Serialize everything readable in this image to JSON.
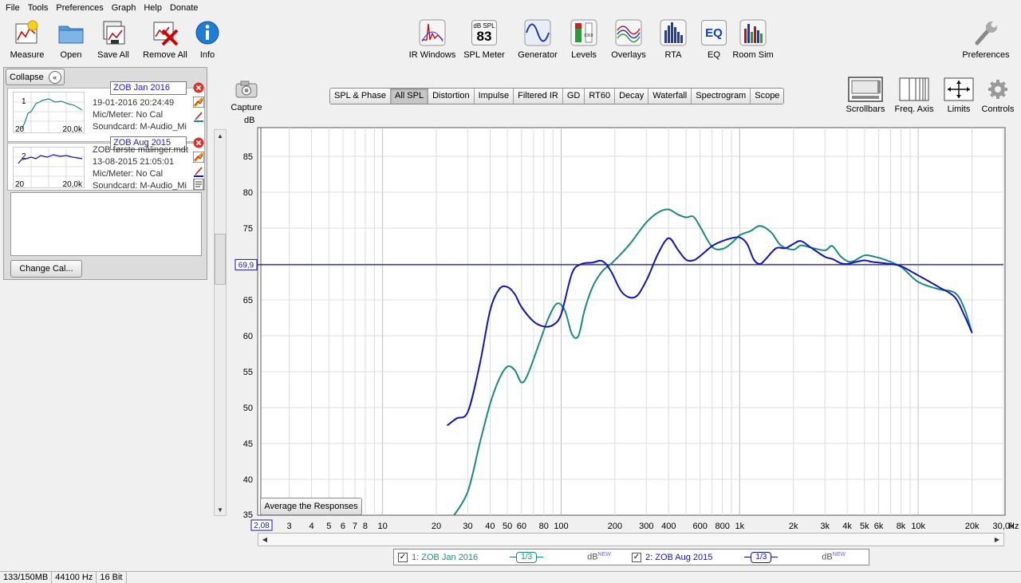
{
  "menu": [
    "File",
    "Tools",
    "Preferences",
    "Graph",
    "Help",
    "Donate"
  ],
  "toolbar_left": [
    {
      "label": "Measure",
      "icon": "measure-icon"
    },
    {
      "label": "Open",
      "icon": "folder-icon"
    },
    {
      "label": "Save All",
      "icon": "save-all-icon"
    },
    {
      "label": "Remove All",
      "icon": "remove-all-icon"
    },
    {
      "label": "Info",
      "icon": "info-icon"
    }
  ],
  "toolbar_center": [
    {
      "label": "IR Windows",
      "icon": "ir-windows-icon"
    },
    {
      "label": "SPL Meter",
      "icon": "spl-meter-icon",
      "top": "dB SPL",
      "value": "83"
    },
    {
      "label": "Generator",
      "icon": "generator-icon"
    },
    {
      "label": "Levels",
      "icon": "levels-icon"
    },
    {
      "label": "Overlays",
      "icon": "overlays-icon"
    },
    {
      "label": "RTA",
      "icon": "rta-icon"
    },
    {
      "label": "EQ",
      "icon": "eq-icon",
      "text": "EQ"
    },
    {
      "label": "Room Sim",
      "icon": "room-sim-icon"
    }
  ],
  "preferences": {
    "label": "Preferences"
  },
  "panel": {
    "collapse": "Collapse",
    "measurements": [
      {
        "num": "1",
        "name": "ZOB Jan 2016",
        "lines": [
          "19-01-2016 20:24:49",
          "Mic/Meter: No Cal",
          "Soundcard: M-Audio_Mi"
        ],
        "x0": "20",
        "x1": "20,0k",
        "color": "#1a8a80"
      },
      {
        "num": "2",
        "name": "ZOB Aug 2015",
        "lines": [
          "ZOB første målinger.mdat",
          "13-08-2015 21:05:01",
          "Mic/Meter: No Cal",
          "Soundcard: M-Audio_Mi"
        ],
        "x0": "20",
        "x1": "20,0k",
        "color": "#1414b4"
      }
    ],
    "change_cal": "Change Cal..."
  },
  "capture": {
    "label": "Capture"
  },
  "tabs": [
    "SPL & Phase",
    "All SPL",
    "Distortion",
    "Impulse",
    "Filtered IR",
    "GD",
    "RT60",
    "Decay",
    "Waterfall",
    "Spectrogram",
    "Scope"
  ],
  "active_tab": "All SPL",
  "right_tools": [
    {
      "label": "Scrollbars",
      "icon": "scrollbars-icon"
    },
    {
      "label": "Freq. Axis",
      "icon": "freq-axis-icon"
    },
    {
      "label": "Limits",
      "icon": "limits-icon"
    },
    {
      "label": "Controls",
      "icon": "controls-icon"
    }
  ],
  "avg_button": "Average the Responses",
  "chart_data": {
    "type": "line",
    "ylabel": "dB",
    "xunit": "Hz",
    "xscale": "log",
    "xlim": [
      2.08,
      30000
    ],
    "ylim": [
      35,
      89
    ],
    "x_ticks": [
      {
        "v": 3,
        "t": "3"
      },
      {
        "v": 4,
        "t": "4"
      },
      {
        "v": 5,
        "t": "5"
      },
      {
        "v": 6,
        "t": "6"
      },
      {
        "v": 7,
        "t": "7"
      },
      {
        "v": 8,
        "t": "8"
      },
      {
        "v": 10,
        "t": "10"
      },
      {
        "v": 20,
        "t": "20"
      },
      {
        "v": 30,
        "t": "30"
      },
      {
        "v": 40,
        "t": "40"
      },
      {
        "v": 50,
        "t": "50"
      },
      {
        "v": 60,
        "t": "60"
      },
      {
        "v": 80,
        "t": "80"
      },
      {
        "v": 100,
        "t": "100"
      },
      {
        "v": 200,
        "t": "200"
      },
      {
        "v": 300,
        "t": "300"
      },
      {
        "v": 400,
        "t": "400"
      },
      {
        "v": 600,
        "t": "600"
      },
      {
        "v": 800,
        "t": "800"
      },
      {
        "v": 1000,
        "t": "1k"
      },
      {
        "v": 2000,
        "t": "2k"
      },
      {
        "v": 3000,
        "t": "3k"
      },
      {
        "v": 4000,
        "t": "4k"
      },
      {
        "v": 5000,
        "t": "5k"
      },
      {
        "v": 6000,
        "t": "6k"
      },
      {
        "v": 8000,
        "t": "8k"
      },
      {
        "v": 10000,
        "t": "10k"
      },
      {
        "v": 20000,
        "t": "20k"
      },
      {
        "v": 30000,
        "t": "30,0k"
      }
    ],
    "x_start_label": "2,08",
    "y_ticks": [
      40,
      45,
      50,
      55,
      60,
      65,
      70,
      75,
      80,
      85
    ],
    "y_tick_labels": [
      "40",
      "45",
      "50",
      "55",
      "60",
      "65",
      "70",
      "75",
      "80",
      "85"
    ],
    "y_bottom_label": "35",
    "cursor_y": 69.9,
    "cursor_label": "69,9",
    "series": [
      {
        "name": "1: ZOB Jan 2016",
        "color": "#1a8a80",
        "points": [
          [
            25,
            34.9
          ],
          [
            30,
            38.3
          ],
          [
            35,
            45
          ],
          [
            40,
            50.5
          ],
          [
            45,
            54
          ],
          [
            50,
            55.7
          ],
          [
            55,
            55.2
          ],
          [
            60,
            53.5
          ],
          [
            65,
            54.6
          ],
          [
            75,
            58.8
          ],
          [
            85,
            62.5
          ],
          [
            95,
            64.5
          ],
          [
            105,
            63.5
          ],
          [
            115,
            60.2
          ],
          [
            125,
            60
          ],
          [
            135,
            63.5
          ],
          [
            150,
            66.8
          ],
          [
            170,
            69
          ],
          [
            190,
            70
          ],
          [
            220,
            71.6
          ],
          [
            250,
            73.2
          ],
          [
            300,
            75.8
          ],
          [
            350,
            77.2
          ],
          [
            400,
            77.6
          ],
          [
            450,
            76.9
          ],
          [
            500,
            76.5
          ],
          [
            550,
            76.6
          ],
          [
            600,
            75.2
          ],
          [
            700,
            72.4
          ],
          [
            800,
            72.1
          ],
          [
            900,
            72.9
          ],
          [
            1000,
            74
          ],
          [
            1150,
            74.6
          ],
          [
            1300,
            75.3
          ],
          [
            1500,
            74.4
          ],
          [
            1700,
            72.6
          ],
          [
            2000,
            72
          ],
          [
            2200,
            72.6
          ],
          [
            2500,
            72.3
          ],
          [
            3000,
            71.9
          ],
          [
            3300,
            72.5
          ],
          [
            3700,
            71
          ],
          [
            4200,
            70.3
          ],
          [
            5000,
            71.2
          ],
          [
            5700,
            71
          ],
          [
            6500,
            70.6
          ],
          [
            8000,
            69.6
          ],
          [
            10000,
            67.5
          ],
          [
            13000,
            66.5
          ],
          [
            16000,
            66
          ],
          [
            18000,
            64
          ],
          [
            20000,
            60.4
          ]
        ]
      },
      {
        "name": "2: ZOB Aug 2015",
        "color": "#1414b4",
        "points": [
          [
            23,
            47.5
          ],
          [
            26,
            48.5
          ],
          [
            30,
            49.4
          ],
          [
            35,
            56
          ],
          [
            40,
            63.5
          ],
          [
            45,
            66.5
          ],
          [
            50,
            66.8
          ],
          [
            55,
            65.8
          ],
          [
            60,
            64
          ],
          [
            70,
            62
          ],
          [
            80,
            61.3
          ],
          [
            90,
            61.5
          ],
          [
            100,
            63
          ],
          [
            115,
            68.7
          ],
          [
            130,
            70
          ],
          [
            150,
            70.2
          ],
          [
            170,
            70.4
          ],
          [
            190,
            69
          ],
          [
            220,
            66
          ],
          [
            260,
            65.4
          ],
          [
            300,
            67.7
          ],
          [
            350,
            71.5
          ],
          [
            400,
            73.6
          ],
          [
            450,
            72
          ],
          [
            500,
            70.6
          ],
          [
            550,
            70.5
          ],
          [
            600,
            71.1
          ],
          [
            700,
            72.5
          ],
          [
            800,
            73.2
          ],
          [
            900,
            73.6
          ],
          [
            1000,
            73.7
          ],
          [
            1100,
            72.8
          ],
          [
            1200,
            70.6
          ],
          [
            1300,
            70
          ],
          [
            1400,
            70.7
          ],
          [
            1600,
            72.2
          ],
          [
            1800,
            72.2
          ],
          [
            2000,
            72.8
          ],
          [
            2200,
            73.2
          ],
          [
            2500,
            72.3
          ],
          [
            3000,
            71
          ],
          [
            3300,
            70.7
          ],
          [
            3700,
            70.1
          ],
          [
            4000,
            70
          ],
          [
            4500,
            70.3
          ],
          [
            5000,
            70.5
          ],
          [
            5500,
            70.3
          ],
          [
            6000,
            70.2
          ],
          [
            7000,
            70
          ],
          [
            8000,
            69.7
          ],
          [
            10000,
            68.4
          ],
          [
            13000,
            66.8
          ],
          [
            16000,
            65.4
          ],
          [
            18000,
            63
          ],
          [
            20000,
            60.4
          ]
        ]
      }
    ]
  },
  "legend": [
    {
      "check": "✓",
      "name": "1: ZOB Jan 2016",
      "smooth": "1/3",
      "db": "dB",
      "new": "NEW",
      "color": "#1a8a80"
    },
    {
      "check": "✓",
      "name": "2: ZOB Aug 2015",
      "smooth": "1/3",
      "db": "dB",
      "new": "NEW",
      "color": "#1414b4"
    }
  ],
  "status": [
    "133/150MB",
    "44100 Hz",
    "16 Bit"
  ]
}
